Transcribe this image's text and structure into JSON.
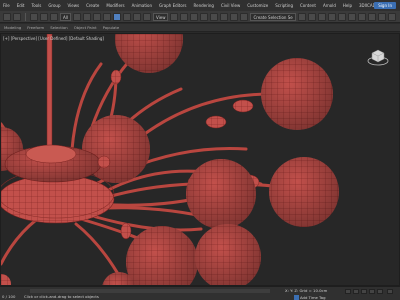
{
  "menubar": {
    "items": [
      "File",
      "Edit",
      "Tools",
      "Group",
      "Views",
      "Create",
      "Modifiers",
      "Animation",
      "Graph Editors",
      "Rendering",
      "Civil View",
      "Customize",
      "Scripting",
      "Content",
      "Arnold",
      "Help",
      "3DXCAD"
    ],
    "signin": "Sign In"
  },
  "toolbar": {
    "filter": "All",
    "view": "View",
    "selection_set": "Create Selection Se"
  },
  "ribbon": {
    "tabs": [
      "Modeling",
      "Freeform",
      "Selection",
      "Object Paint",
      "Populate"
    ]
  },
  "viewport": {
    "label": "[+] [Perspective] [User Defined] [Default Shading]"
  },
  "statusbar": {
    "status": "0 / 100",
    "hint": "Click or click-and-drag to select objects",
    "coord": "X:  Y:  Z:   Grid = 10.0cm",
    "add_time_tag": "Add Time Tag"
  },
  "colors": {
    "model": "#c0504a",
    "wire": "#6e1c1a",
    "viewport_bg": "#272727",
    "accent": "#3b6fb3"
  }
}
